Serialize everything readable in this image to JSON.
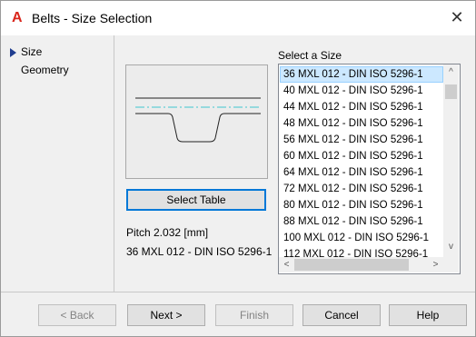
{
  "window": {
    "title": "Belts - Size Selection",
    "close_glyph": "✕",
    "app_icon": "A"
  },
  "nav": {
    "items": [
      {
        "label": "Size",
        "active": true
      },
      {
        "label": "Geometry",
        "active": false
      }
    ]
  },
  "preview": {
    "icon": "belt-profile-diagram"
  },
  "select_table_label": "Select Table",
  "pitch_text": "Pitch 2.032 [mm]",
  "selected_size_text": "36 MXL 012 - DIN ISO 5296-1",
  "size_list": {
    "label": "Select a Size",
    "selected_index": 0,
    "items": [
      "36 MXL 012 - DIN ISO 5296-1",
      "40 MXL 012 - DIN ISO 5296-1",
      "44 MXL 012 - DIN ISO 5296-1",
      "48 MXL 012 - DIN ISO 5296-1",
      "56 MXL 012 - DIN ISO 5296-1",
      "60 MXL 012 - DIN ISO 5296-1",
      "64 MXL 012 - DIN ISO 5296-1",
      "72 MXL 012 - DIN ISO 5296-1",
      "80 MXL 012 - DIN ISO 5296-1",
      "88 MXL 012 - DIN ISO 5296-1",
      "100 MXL 012 - DIN ISO 5296-1",
      "112 MXL 012 - DIN ISO 5296-1"
    ],
    "scroll_up": "^",
    "scroll_down": "v",
    "scroll_left": "<",
    "scroll_right": ">"
  },
  "buttons": {
    "back": "< Back",
    "next": "Next >",
    "finish": "Finish",
    "cancel": "Cancel",
    "help": "Help"
  },
  "colors": {
    "accent": "#0078d7",
    "selection": "#cce8ff",
    "centerline": "#3fc6cf",
    "brand": "#d9261c"
  }
}
